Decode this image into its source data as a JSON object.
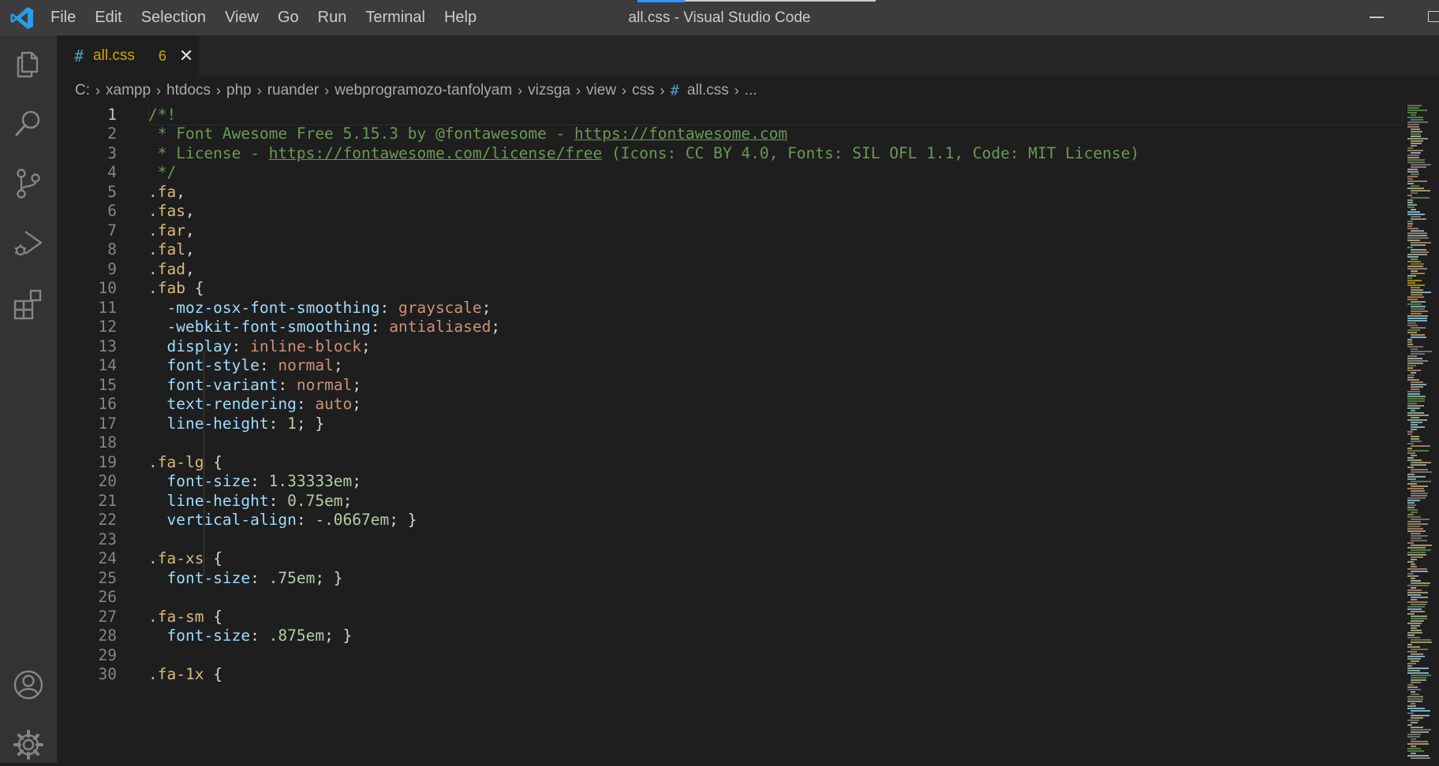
{
  "window": {
    "title": "all.css - Visual Studio Code"
  },
  "menu": [
    "File",
    "Edit",
    "Selection",
    "View",
    "Go",
    "Run",
    "Terminal",
    "Help"
  ],
  "activity_bar": [
    "explorer-icon",
    "search-icon",
    "source-control-icon",
    "run-debug-icon",
    "extensions-icon",
    "account-icon",
    "manage-gear-icon"
  ],
  "tab": {
    "hash": "#",
    "name": "all.css",
    "problems": "6",
    "close": "✕"
  },
  "breadcrumb": {
    "segments": [
      "C:",
      "xampp",
      "htdocs",
      "php",
      "ruander",
      "webprogramozo-tanfolyam",
      "vizsga",
      "view",
      "css"
    ],
    "file_hash": "#",
    "file": "all.css",
    "more": "..."
  },
  "editor": {
    "active_line": 1,
    "lines": [
      {
        "n": "1",
        "t": [
          [
            "/*!",
            "c-comment"
          ]
        ]
      },
      {
        "n": "2",
        "t": [
          [
            " * Font Awesome Free 5.15.3 by @fontawesome - ",
            "c-comment"
          ],
          [
            "https://fontawesome.com",
            "c-link"
          ]
        ]
      },
      {
        "n": "3",
        "t": [
          [
            " * License - ",
            "c-comment"
          ],
          [
            "https://fontawesome.com/license/free",
            "c-link"
          ],
          [
            " (Icons: CC BY 4.0, Fonts: SIL OFL 1.1, Code: MIT License)",
            "c-comment"
          ]
        ]
      },
      {
        "n": "4",
        "t": [
          [
            " */",
            "c-comment"
          ]
        ]
      },
      {
        "n": "5",
        "t": [
          [
            ".fa",
            "c-sel"
          ],
          [
            ",",
            "c-punc"
          ]
        ]
      },
      {
        "n": "6",
        "t": [
          [
            ".fas",
            "c-sel"
          ],
          [
            ",",
            "c-punc"
          ]
        ]
      },
      {
        "n": "7",
        "t": [
          [
            ".far",
            "c-sel"
          ],
          [
            ",",
            "c-punc"
          ]
        ]
      },
      {
        "n": "8",
        "t": [
          [
            ".fal",
            "c-sel"
          ],
          [
            ",",
            "c-punc"
          ]
        ]
      },
      {
        "n": "9",
        "t": [
          [
            ".fad",
            "c-sel"
          ],
          [
            ",",
            "c-punc"
          ]
        ]
      },
      {
        "n": "10",
        "t": [
          [
            ".fab",
            "c-sel"
          ],
          [
            " {",
            "c-punc"
          ]
        ]
      },
      {
        "n": "11",
        "t": [
          [
            "  -moz-osx-font-smoothing",
            "c-prop"
          ],
          [
            ": ",
            "c-punc"
          ],
          [
            "grayscale",
            "c-val"
          ],
          [
            ";",
            "c-punc"
          ]
        ]
      },
      {
        "n": "12",
        "t": [
          [
            "  -webkit-font-smoothing",
            "c-prop"
          ],
          [
            ": ",
            "c-punc"
          ],
          [
            "antialiased",
            "c-val"
          ],
          [
            ";",
            "c-punc"
          ]
        ]
      },
      {
        "n": "13",
        "t": [
          [
            "  display",
            "c-prop"
          ],
          [
            ": ",
            "c-punc"
          ],
          [
            "inline-block",
            "c-val"
          ],
          [
            ";",
            "c-punc"
          ]
        ]
      },
      {
        "n": "14",
        "t": [
          [
            "  font-style",
            "c-prop"
          ],
          [
            ": ",
            "c-punc"
          ],
          [
            "normal",
            "c-val"
          ],
          [
            ";",
            "c-punc"
          ]
        ]
      },
      {
        "n": "15",
        "t": [
          [
            "  font-variant",
            "c-prop"
          ],
          [
            ": ",
            "c-punc"
          ],
          [
            "normal",
            "c-val"
          ],
          [
            ";",
            "c-punc"
          ]
        ]
      },
      {
        "n": "16",
        "t": [
          [
            "  text-rendering",
            "c-prop"
          ],
          [
            ": ",
            "c-punc"
          ],
          [
            "auto",
            "c-val"
          ],
          [
            ";",
            "c-punc"
          ]
        ]
      },
      {
        "n": "17",
        "t": [
          [
            "  line-height",
            "c-prop"
          ],
          [
            ": ",
            "c-punc"
          ],
          [
            "1",
            "c-num"
          ],
          [
            "; }",
            "c-punc"
          ]
        ]
      },
      {
        "n": "18",
        "t": []
      },
      {
        "n": "19",
        "t": [
          [
            ".fa-lg",
            "c-sel"
          ],
          [
            " {",
            "c-punc"
          ]
        ]
      },
      {
        "n": "20",
        "t": [
          [
            "  font-size",
            "c-prop"
          ],
          [
            ": ",
            "c-punc"
          ],
          [
            "1.33333em",
            "c-num"
          ],
          [
            ";",
            "c-punc"
          ]
        ]
      },
      {
        "n": "21",
        "t": [
          [
            "  line-height",
            "c-prop"
          ],
          [
            ": ",
            "c-punc"
          ],
          [
            "0.75em",
            "c-num"
          ],
          [
            ";",
            "c-punc"
          ]
        ]
      },
      {
        "n": "22",
        "t": [
          [
            "  vertical-align",
            "c-prop"
          ],
          [
            ": ",
            "c-punc"
          ],
          [
            "-.0667em",
            "c-num"
          ],
          [
            "; }",
            "c-punc"
          ]
        ]
      },
      {
        "n": "23",
        "t": []
      },
      {
        "n": "24",
        "t": [
          [
            ".fa-xs",
            "c-sel"
          ],
          [
            " {",
            "c-punc"
          ]
        ]
      },
      {
        "n": "25",
        "t": [
          [
            "  font-size",
            "c-prop"
          ],
          [
            ": ",
            "c-punc"
          ],
          [
            ".75em",
            "c-num"
          ],
          [
            "; }",
            "c-punc"
          ]
        ]
      },
      {
        "n": "26",
        "t": []
      },
      {
        "n": "27",
        "t": [
          [
            ".fa-sm",
            "c-sel"
          ],
          [
            " {",
            "c-punc"
          ]
        ]
      },
      {
        "n": "28",
        "t": [
          [
            "  font-size",
            "c-prop"
          ],
          [
            ": ",
            "c-punc"
          ],
          [
            ".875em",
            "c-num"
          ],
          [
            "; }",
            "c-punc"
          ]
        ]
      },
      {
        "n": "29",
        "t": []
      },
      {
        "n": "30",
        "t": [
          [
            ".fa-1x",
            "c-sel"
          ],
          [
            " {",
            "c-punc"
          ]
        ]
      }
    ]
  },
  "colors": {
    "titlebar": "#3c3c3c",
    "activitybar": "#333333",
    "editor_bg": "#1e1e1e",
    "selector": "#d7ba7d",
    "property": "#9cdcfe",
    "value": "#ce9178",
    "number": "#b5cea8",
    "comment": "#6a9955",
    "warning": "#cca700"
  }
}
